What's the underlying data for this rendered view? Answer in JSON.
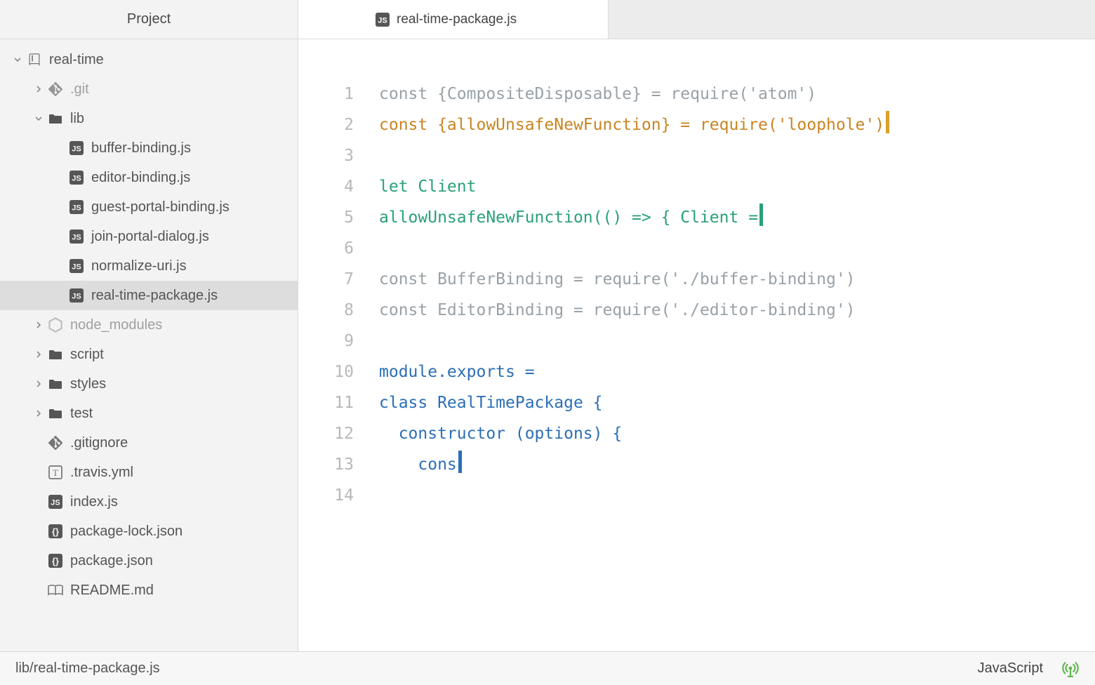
{
  "sidebar": {
    "title": "Project",
    "tree": [
      {
        "kind": "repo",
        "label": "real-time",
        "depth": 0,
        "chev": "down",
        "muted": false,
        "sel": false
      },
      {
        "kind": "git",
        "label": ".git",
        "depth": 1,
        "chev": "right",
        "muted": true,
        "sel": false
      },
      {
        "kind": "folder",
        "label": "lib",
        "depth": 1,
        "chev": "down",
        "muted": false,
        "sel": false
      },
      {
        "kind": "js",
        "label": "buffer-binding.js",
        "depth": 2,
        "chev": "",
        "muted": false,
        "sel": false
      },
      {
        "kind": "js",
        "label": "editor-binding.js",
        "depth": 2,
        "chev": "",
        "muted": false,
        "sel": false
      },
      {
        "kind": "js",
        "label": "guest-portal-binding.js",
        "depth": 2,
        "chev": "",
        "muted": false,
        "sel": false
      },
      {
        "kind": "js",
        "label": "join-portal-dialog.js",
        "depth": 2,
        "chev": "",
        "muted": false,
        "sel": false
      },
      {
        "kind": "js",
        "label": "normalize-uri.js",
        "depth": 2,
        "chev": "",
        "muted": false,
        "sel": false
      },
      {
        "kind": "js",
        "label": "real-time-package.js",
        "depth": 2,
        "chev": "",
        "muted": false,
        "sel": true
      },
      {
        "kind": "node",
        "label": "node_modules",
        "depth": 1,
        "chev": "right",
        "muted": true,
        "sel": false
      },
      {
        "kind": "folder",
        "label": "script",
        "depth": 1,
        "chev": "right",
        "muted": false,
        "sel": false
      },
      {
        "kind": "folder",
        "label": "styles",
        "depth": 1,
        "chev": "right",
        "muted": false,
        "sel": false
      },
      {
        "kind": "folder",
        "label": "test",
        "depth": 1,
        "chev": "right",
        "muted": false,
        "sel": false
      },
      {
        "kind": "git",
        "label": ".gitignore",
        "depth": 1,
        "chev": "",
        "muted": false,
        "sel": false
      },
      {
        "kind": "travis",
        "label": ".travis.yml",
        "depth": 1,
        "chev": "",
        "muted": false,
        "sel": false
      },
      {
        "kind": "js",
        "label": "index.js",
        "depth": 1,
        "chev": "",
        "muted": false,
        "sel": false
      },
      {
        "kind": "brackets",
        "label": "package-lock.json",
        "depth": 1,
        "chev": "",
        "muted": false,
        "sel": false
      },
      {
        "kind": "brackets",
        "label": "package.json",
        "depth": 1,
        "chev": "",
        "muted": false,
        "sel": false
      },
      {
        "kind": "book",
        "label": "README.md",
        "depth": 1,
        "chev": "",
        "muted": false,
        "sel": false
      }
    ]
  },
  "tabs": [
    {
      "icon": "js",
      "label": "real-time-package.js",
      "active": true
    }
  ],
  "code": {
    "lines": [
      {
        "n": 1,
        "segs": [
          {
            "t": "const {CompositeDisposable} = require('atom')",
            "c": "grey"
          }
        ]
      },
      {
        "n": 2,
        "segs": [
          {
            "t": "const {allowUnsafeNewFunction} = require('loophole')",
            "c": "orange"
          }
        ],
        "cursor": "orange"
      },
      {
        "n": 3,
        "segs": []
      },
      {
        "n": 4,
        "segs": [
          {
            "t": "let Client",
            "c": "green"
          }
        ]
      },
      {
        "n": 5,
        "segs": [
          {
            "t": "allowUnsafeNewFunction(() => { Client =",
            "c": "green"
          }
        ],
        "cursor": "green"
      },
      {
        "n": 6,
        "segs": []
      },
      {
        "n": 7,
        "segs": [
          {
            "t": "const BufferBinding = require('./buffer-binding')",
            "c": "grey"
          }
        ]
      },
      {
        "n": 8,
        "segs": [
          {
            "t": "const EditorBinding = require('./editor-binding')",
            "c": "grey"
          }
        ]
      },
      {
        "n": 9,
        "segs": []
      },
      {
        "n": 10,
        "segs": [
          {
            "t": "module.exports =",
            "c": "blue"
          }
        ]
      },
      {
        "n": 11,
        "segs": [
          {
            "t": "class RealTimePackage {",
            "c": "blue"
          }
        ]
      },
      {
        "n": 12,
        "segs": [
          {
            "t": "  constructor (options) {",
            "c": "blue"
          }
        ]
      },
      {
        "n": 13,
        "segs": [
          {
            "t": "    cons",
            "c": "blue"
          }
        ],
        "cursor": "blue"
      },
      {
        "n": 14,
        "segs": []
      }
    ]
  },
  "status": {
    "path": "lib/real-time-package.js",
    "language": "JavaScript"
  }
}
